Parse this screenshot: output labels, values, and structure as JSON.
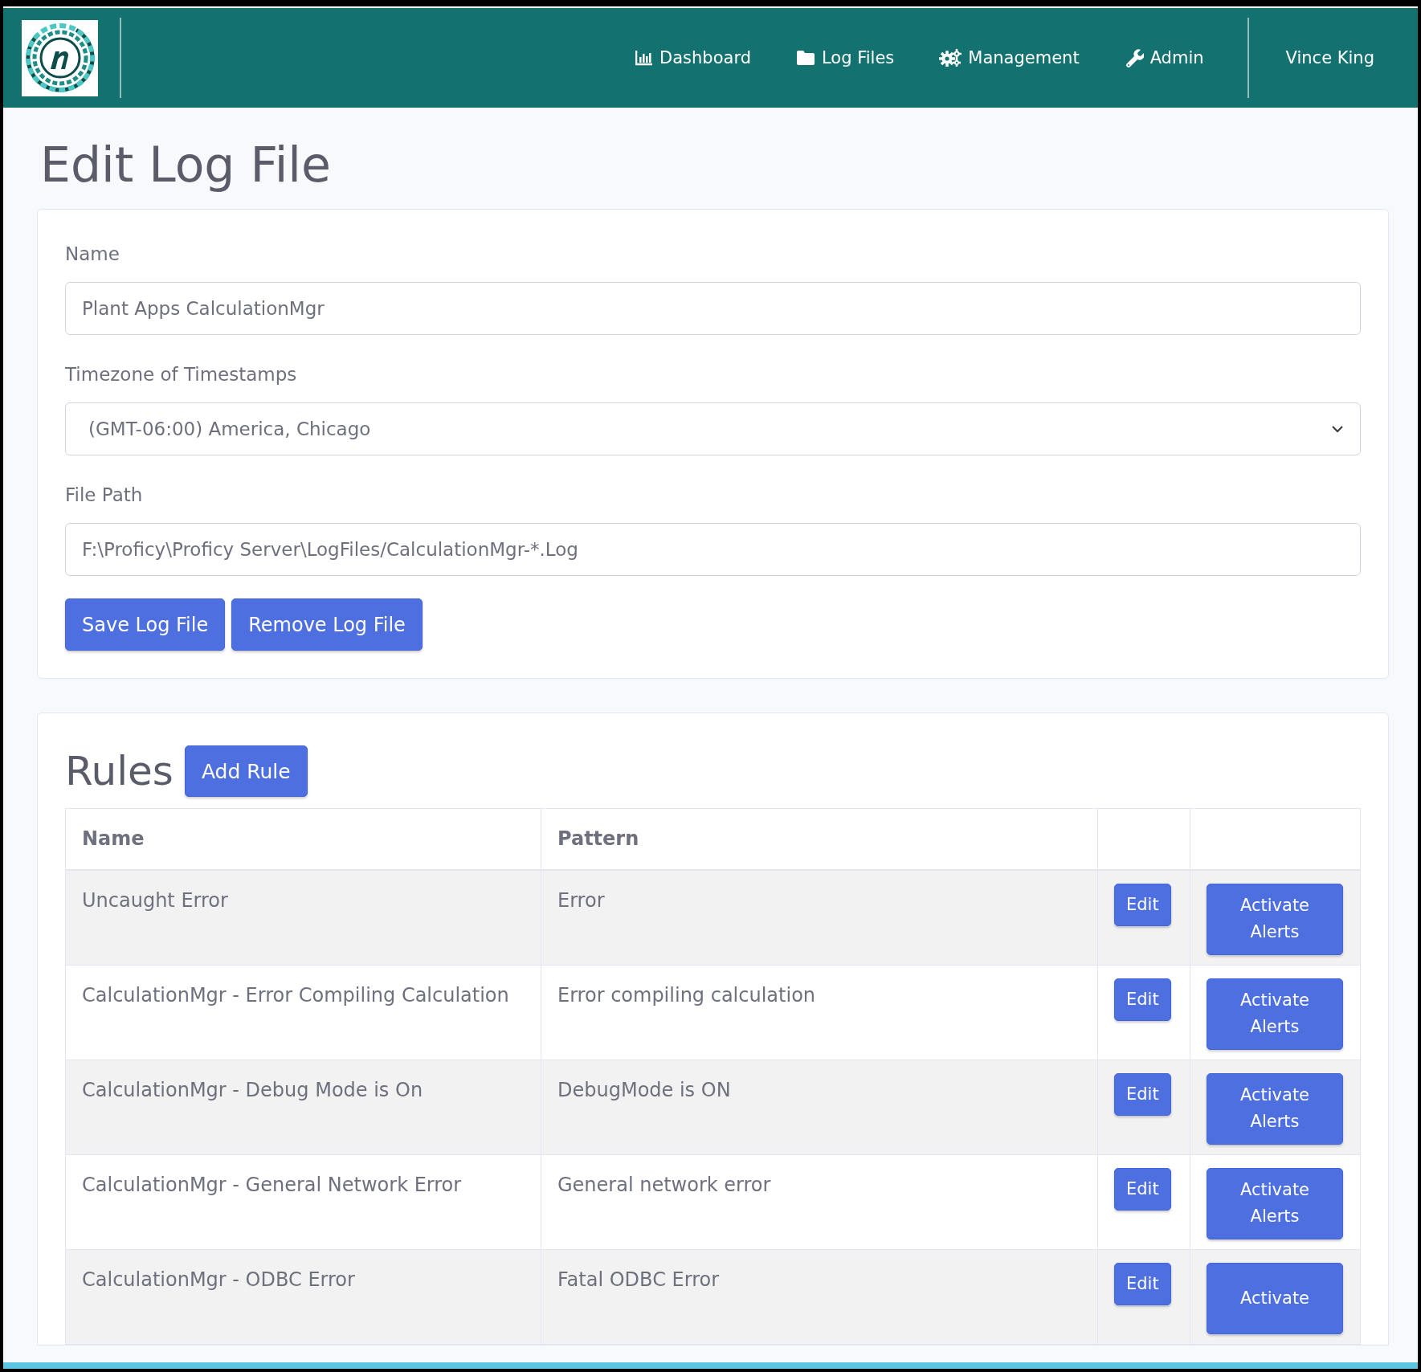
{
  "navbar": {
    "items": [
      {
        "kind": "chart",
        "label": "Dashboard"
      },
      {
        "kind": "folder",
        "label": "Log Files"
      },
      {
        "kind": "gears",
        "label": "Management"
      },
      {
        "kind": "wrench",
        "label": "Admin"
      }
    ],
    "user": "Vince King"
  },
  "page_title": "Edit Log File",
  "form": {
    "fields": [
      {
        "kind": "text",
        "label": "Name",
        "value": "Plant Apps CalculationMgr"
      },
      {
        "kind": "select",
        "label": "Timezone of Timestamps",
        "value": "(GMT-06:00) America, Chicago"
      },
      {
        "kind": "text",
        "label": "File Path",
        "value": "F:\\Proficy\\Proficy Server\\LogFiles/CalculationMgr-*.Log"
      }
    ],
    "buttons": [
      "Save Log File",
      "Remove Log File"
    ]
  },
  "rules": {
    "title": "Rules",
    "add_button": "Add Rule",
    "columns": [
      "Name",
      "Pattern"
    ],
    "rows": [
      {
        "name": "Uncaught Error",
        "pattern": "Error",
        "edit": "Edit",
        "action": "Activate Alerts"
      },
      {
        "name": "CalculationMgr - Error Compiling Calculation",
        "pattern": "Error compiling calculation",
        "edit": "Edit",
        "action": "Activate Alerts"
      },
      {
        "name": "CalculationMgr - Debug Mode is On",
        "pattern": "DebugMode is ON",
        "edit": "Edit",
        "action": "Activate Alerts"
      },
      {
        "name": "CalculationMgr - General Network Error",
        "pattern": "General network error",
        "edit": "Edit",
        "action": "Activate Alerts"
      },
      {
        "name": "CalculationMgr - ODBC Error",
        "pattern": "Fatal ODBC Error",
        "edit": "Edit",
        "action": "Activate"
      }
    ]
  }
}
